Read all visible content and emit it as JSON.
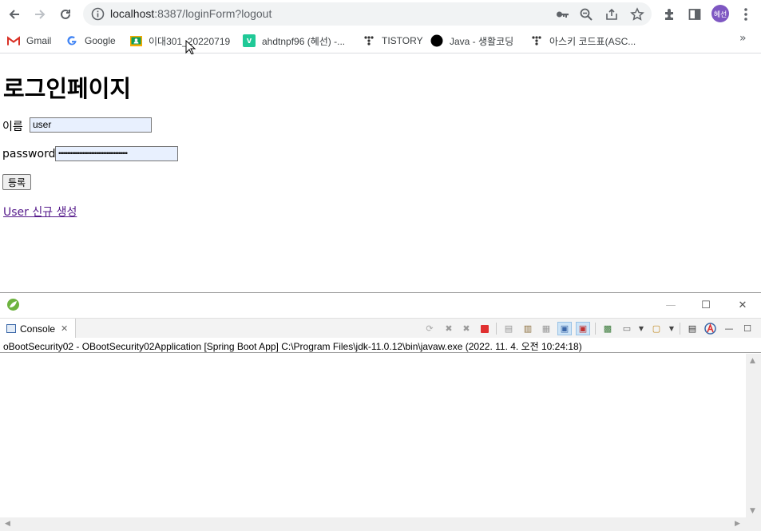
{
  "browser": {
    "url_host": "localhost",
    "url_path": ":8387/loginForm?logout",
    "avatar_text": "혜선",
    "icons": [
      "back-arrow-icon",
      "forward-arrow-icon",
      "reload-icon",
      "info-icon",
      "key-icon",
      "zoom-icon",
      "share-icon",
      "star-icon",
      "extension-icon",
      "side-panel-icon",
      "menu-kebab-icon"
    ]
  },
  "bookmarks": [
    {
      "label": "Gmail",
      "icon": "gmail-icon",
      "color": "#d93025"
    },
    {
      "label": "Google",
      "icon": "google-icon",
      "color": "#4285f4"
    },
    {
      "label": "이대301_20220719",
      "icon": "classroom-icon",
      "color": "#f9ab00"
    },
    {
      "label": "ahdtnpf96 (혜선) -...",
      "icon": "velog-icon",
      "color": "#20c997"
    },
    {
      "label": "TISTORY",
      "icon": "tistory-icon",
      "color": "#333333"
    },
    {
      "label": "Java - 생활코딩",
      "icon": "circle-icon",
      "color": "#000000"
    },
    {
      "label": "아스키 코드표(ASC...",
      "icon": "tistory-icon",
      "color": "#333333"
    }
  ],
  "page": {
    "title": "로그인페이지",
    "username_label": "이름",
    "username_value": "user",
    "password_label": "password",
    "password_value": "••••••••••••••••••••••••••••••••••••••••",
    "submit_label": "등록",
    "new_user_link": "User 신규 생성"
  },
  "eclipse": {
    "tab_label": "Console",
    "description": "oBootSecurity02 - OBootSecurity02Application [Spring Boot App] C:\\Program Files\\jdk-11.0.12\\bin\\javaw.exe  (2022. 11. 4. 오전 10:24:18)"
  }
}
